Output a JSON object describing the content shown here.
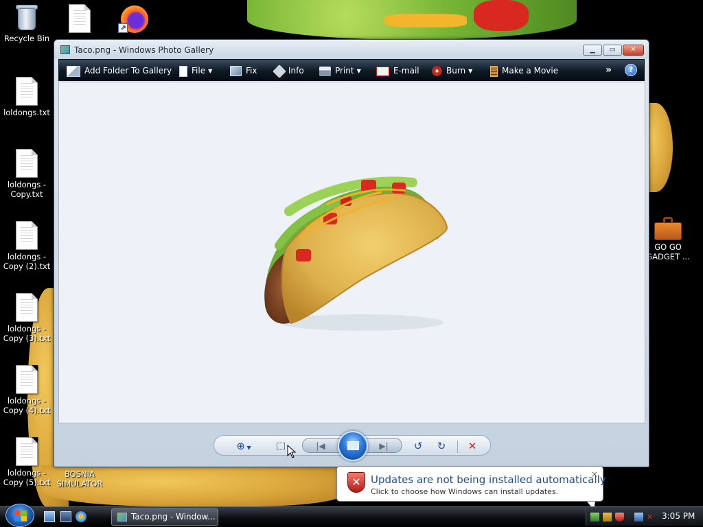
{
  "desktop": {
    "icons": [
      {
        "label": "Recycle Bin"
      },
      {
        "label": "loldongs.txt"
      },
      {
        "label": "loldongs - Copy.txt"
      },
      {
        "label": "loldongs - Copy (2).txt"
      },
      {
        "label": "loldongs - Copy (3).txt"
      },
      {
        "label": "loldongs - Copy (4).txt"
      },
      {
        "label": "loldongs - Copy (5).txt"
      },
      {
        "label": "BOSNIA SIMULATOR"
      },
      {
        "label": "GO GO GADGET ..."
      }
    ]
  },
  "window": {
    "title": "Taco.png - Windows Photo Gallery",
    "toolbar": {
      "add_folder": "Add Folder To Gallery",
      "file": "File",
      "fix": "Fix",
      "info": "Info",
      "print": "Print",
      "email": "E-mail",
      "burn": "Burn",
      "make_movie": "Make a Movie",
      "more": "»",
      "help": "?"
    },
    "image_name": "Taco.png"
  },
  "notification": {
    "title": "Updates are not being installed automatically",
    "body": "Click to choose how Windows can install updates.",
    "close": "×"
  },
  "taskbar": {
    "task_label": "Taco.png - Window...",
    "clock": "3:05 PM"
  },
  "colors": {
    "toolbar_bg": "#0f1a26",
    "viewer_bg": "#eef2f8",
    "accent_blue": "#1f4f8e",
    "delete_red": "#d0281c"
  }
}
